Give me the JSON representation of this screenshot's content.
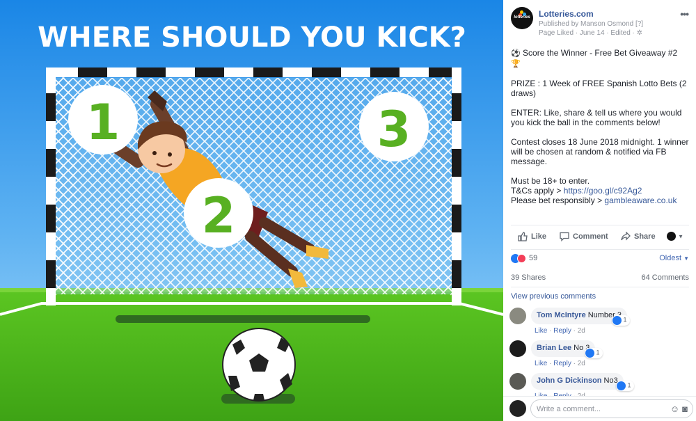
{
  "image": {
    "headline": "WHERE SHOULD YOU KICK?",
    "target_1": "1",
    "target_2": "2",
    "target_3": "3"
  },
  "post": {
    "page_name": "Lotteries.com",
    "published_by": "Published by Manson Osmond",
    "published_by_suffix": "[?]",
    "meta": "Page Liked · June 14 · Edited ·",
    "avatar_text": "lotteries",
    "title_emoji_left": "⚽",
    "title": "Score the Winner - Free Bet Giveaway #2",
    "title_emoji_right": "🏆",
    "prize": "PRIZE : 1 Week of FREE Spanish Lotto Bets (2 draws)",
    "enter": "ENTER: Like, share & tell us where you would you kick the ball in the comments below!",
    "closes": "Contest closes 18 June 2018 midnight. 1 winner will be chosen at random & notified via FB message.",
    "age": "Must be 18+ to enter.",
    "tcs_prefix": "T&Cs apply > ",
    "tcs_link": "https://goo.gl/c92Ag2",
    "bet_prefix": "Please bet responsibly > ",
    "bet_link": "gambleaware.co.uk"
  },
  "actions": {
    "like": "Like",
    "comment": "Comment",
    "share": "Share"
  },
  "reactions": {
    "count": "59",
    "sort": "Oldest"
  },
  "stats": {
    "shares": "39 Shares",
    "comments": "64 Comments"
  },
  "view_previous": "View previous comments",
  "comments": [
    {
      "name": "Tom McIntyre",
      "text": "Number 3",
      "likes": "1",
      "like": "Like",
      "reply": "Reply",
      "age": "2d"
    },
    {
      "name": "Brian Lee",
      "text": "No 3",
      "likes": "1",
      "like": "Like",
      "reply": "Reply",
      "age": "2d"
    },
    {
      "name": "John G Dickinson",
      "text": "No3",
      "likes": "1",
      "like": "Like",
      "reply": "Reply",
      "age": "2d"
    }
  ],
  "composer": {
    "placeholder": "Write a comment..."
  },
  "colors": {
    "fb_blue": "#365899",
    "sky_top": "#1e8ae6",
    "grass": "#4fb81d",
    "target_green": "#58b022"
  }
}
